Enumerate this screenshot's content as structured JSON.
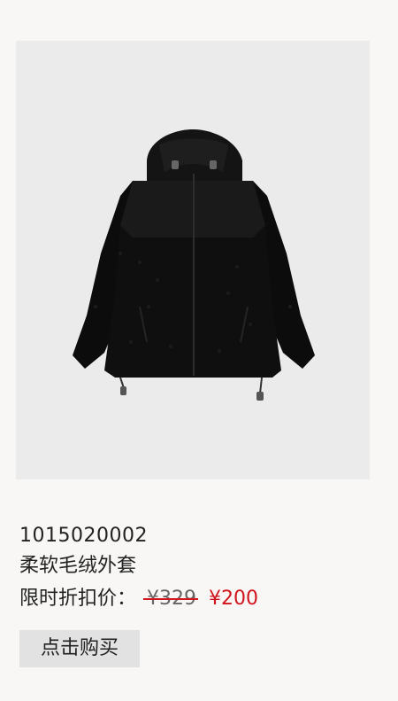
{
  "product": {
    "sku": "1015020002",
    "name": "柔软毛绒外套",
    "price_label": "限时折扣价：",
    "original_price": "¥329",
    "sale_price": "¥200",
    "image_icon": "black-fleece-hooded-jacket",
    "accent_color": "#d0151d"
  },
  "actions": {
    "buy_label": "点击购买"
  }
}
